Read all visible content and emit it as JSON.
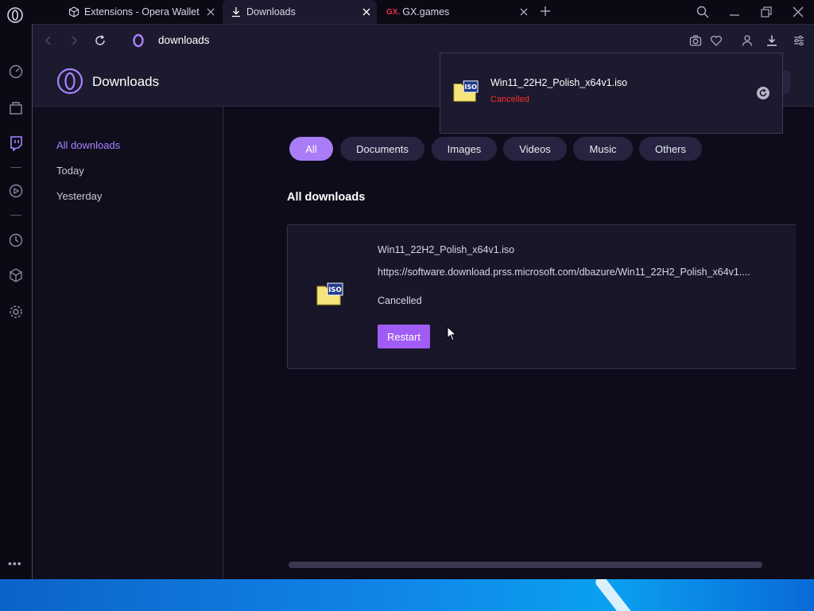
{
  "tabs": [
    {
      "label": "Extensions - Opera Wallet",
      "icon": "cube-icon"
    },
    {
      "label": "Downloads",
      "icon": "download-icon",
      "active": true
    },
    {
      "label": "GX.games",
      "prefix": "GX."
    }
  ],
  "addressbar": {
    "url": "downloads"
  },
  "page": {
    "title": "Downloads"
  },
  "leftnav": {
    "items": [
      {
        "label": "All downloads",
        "active": true
      },
      {
        "label": "Today"
      },
      {
        "label": "Yesterday"
      }
    ]
  },
  "filters": {
    "items": [
      "All",
      "Documents",
      "Images",
      "Videos",
      "Music",
      "Others"
    ],
    "active": "All"
  },
  "section": {
    "title": "All downloads"
  },
  "download": {
    "name": "Win11_22H2_Polish_x64v1.iso",
    "url": "https://software.download.prss.microsoft.com/dbazure/Win11_22H2_Polish_x64v1....",
    "status": "Cancelled",
    "restart_label": "Restart"
  },
  "popup": {
    "name": "Win11_22H2_Polish_x64v1.iso",
    "status": "Cancelled"
  },
  "iso_label": "ISO",
  "colors": {
    "accent": "#a97cf8",
    "button": "#a05cf5",
    "cancelled_red": "#ff2828",
    "background": "#0e0c1a"
  },
  "more_label": "•••"
}
